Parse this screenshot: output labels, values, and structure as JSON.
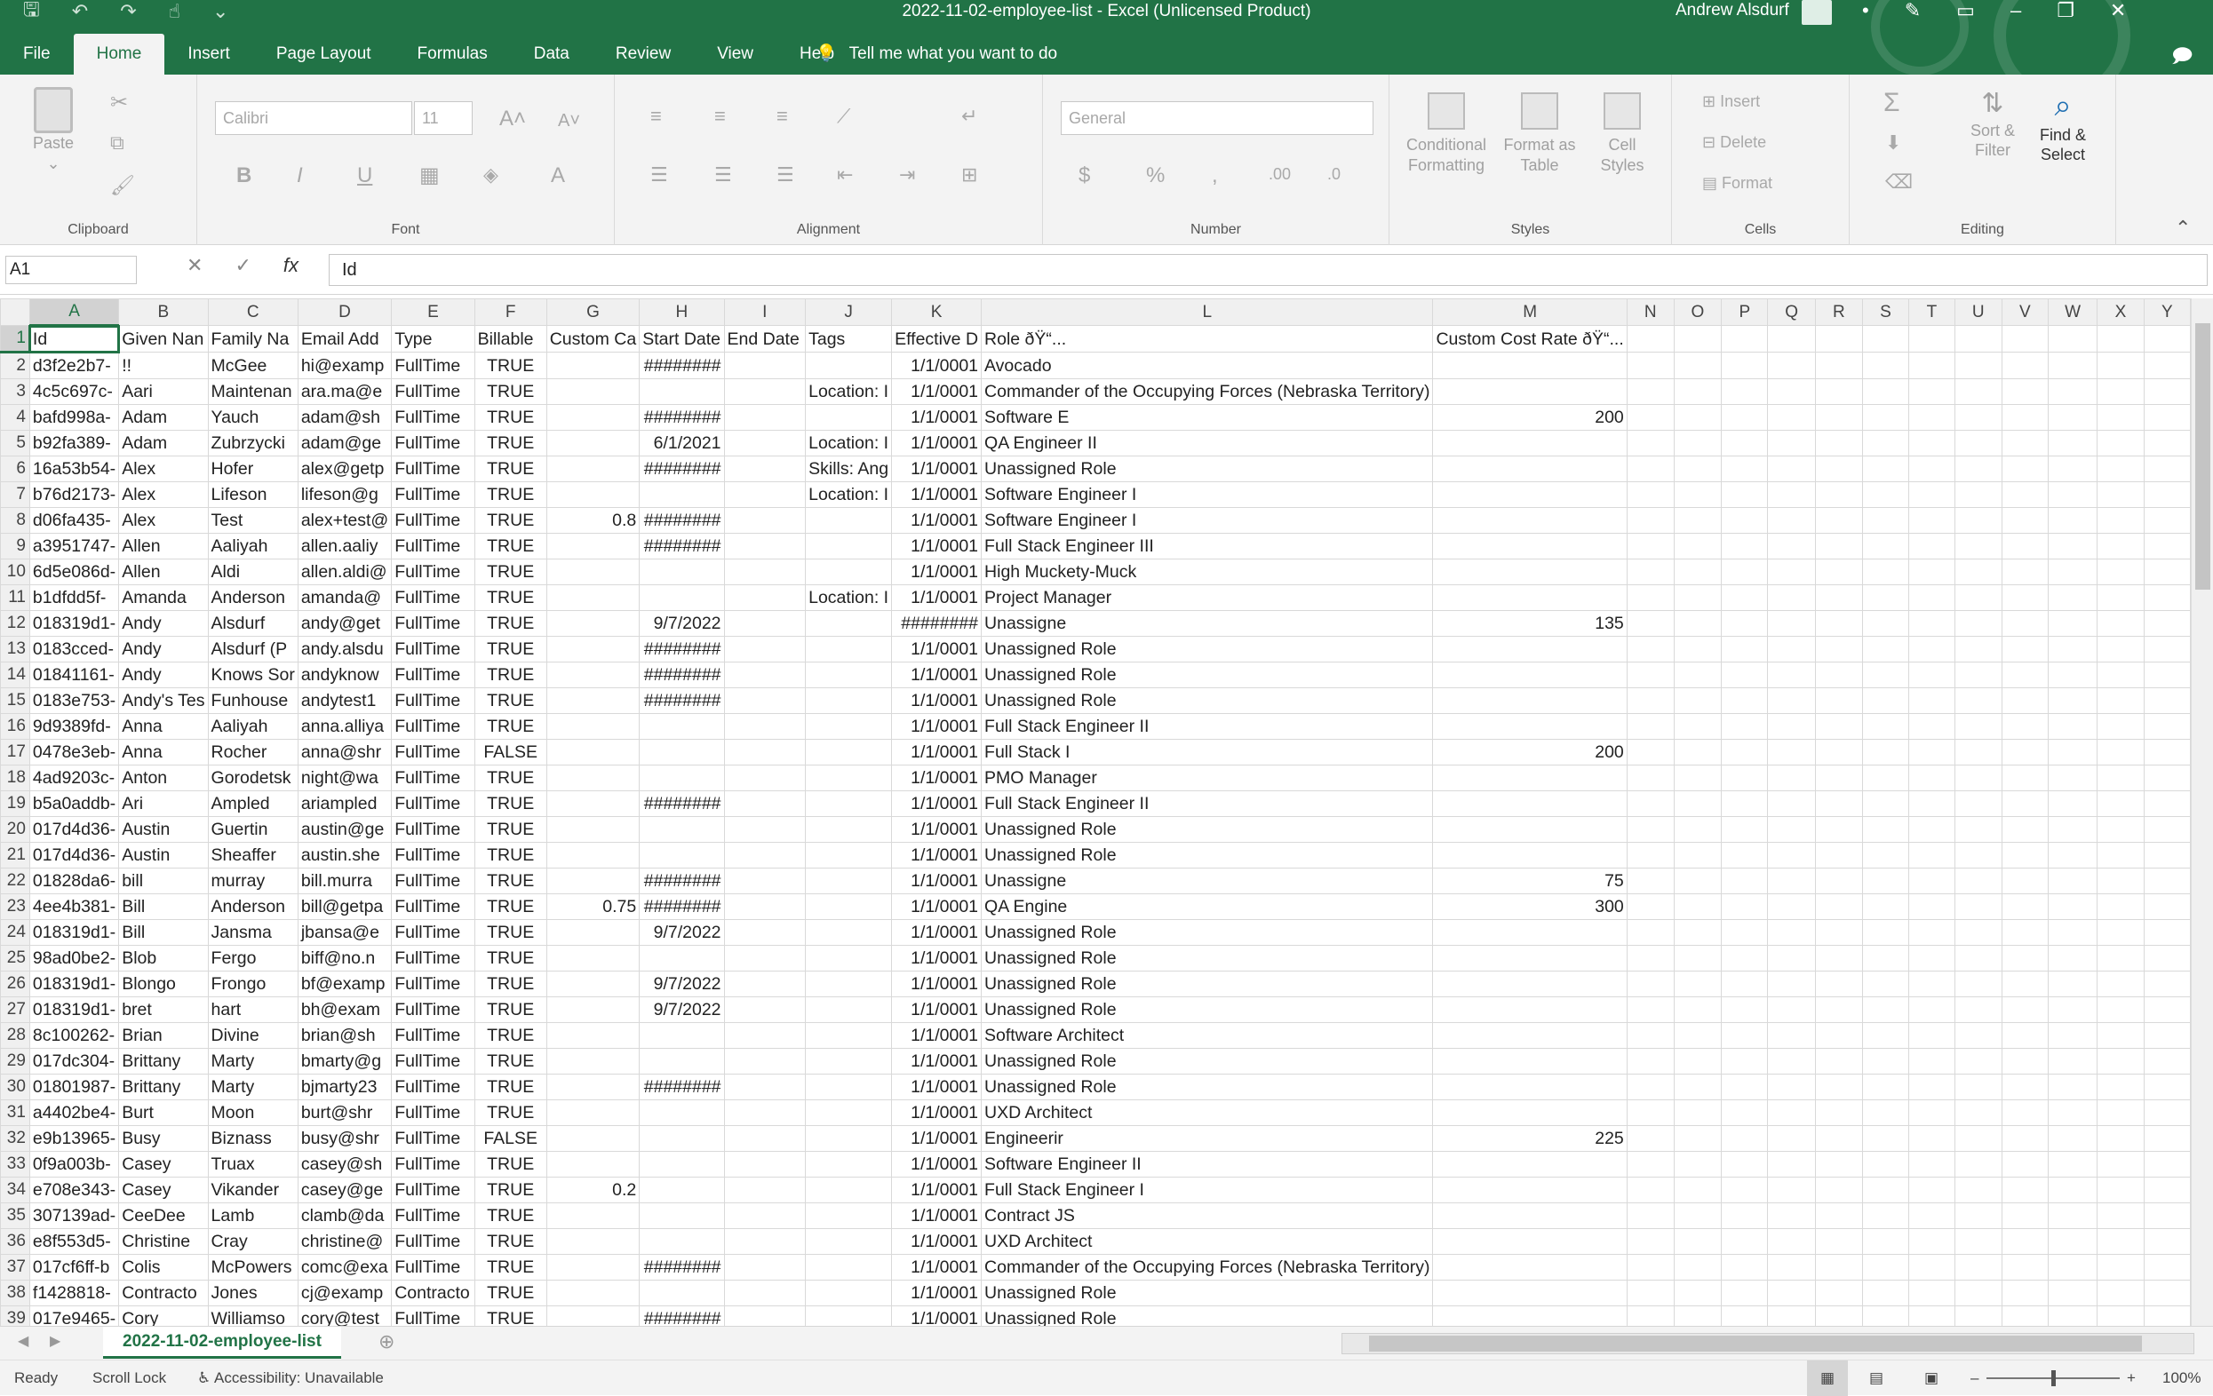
{
  "window": {
    "title": "2022-11-02-employee-list  -  Excel (Unlicensed Product)",
    "user": "Andrew Alsdurf"
  },
  "tabs": [
    "File",
    "Home",
    "Insert",
    "Page Layout",
    "Formulas",
    "Data",
    "Review",
    "View",
    "Help"
  ],
  "tell_me": "Tell me what you want to do",
  "ribbon": {
    "clipboard": {
      "label": "Clipboard",
      "paste": "Paste"
    },
    "font": {
      "label": "Font",
      "name": "Calibri",
      "size": "11"
    },
    "alignment": {
      "label": "Alignment"
    },
    "number": {
      "label": "Number",
      "format": "General"
    },
    "styles": {
      "label": "Styles",
      "conditional": "Conditional Formatting",
      "format_table": "Format as Table",
      "cell_styles": "Cell Styles"
    },
    "cells": {
      "label": "Cells",
      "insert": "Insert",
      "delete": "Delete",
      "format": "Format"
    },
    "editing": {
      "label": "Editing",
      "sort": "Sort & Filter",
      "find": "Find & Select"
    }
  },
  "formula_bar": {
    "name_box": "A1",
    "formula": "Id"
  },
  "columns": [
    "A",
    "B",
    "C",
    "D",
    "E",
    "F",
    "G",
    "H",
    "I",
    "J",
    "K",
    "L",
    "M",
    "N",
    "O",
    "P",
    "Q",
    "R",
    "S",
    "T",
    "U",
    "V",
    "W",
    "X",
    "Y"
  ],
  "headers": [
    "Id",
    "Given Nan",
    "Family Na",
    "Email Add",
    "Type",
    "Billable",
    "Custom Ca",
    "Start Date",
    "End Date",
    "Tags",
    "Effective D",
    "Role ðŸ“...",
    "Custom Cost Rate ðŸ“..."
  ],
  "rows": [
    [
      "d3f2e2b7-",
      "!!",
      "McGee",
      "hi@examp",
      "FullTime",
      "TRUE",
      "",
      "########",
      "",
      "",
      "1/1/0001",
      "Avocado",
      ""
    ],
    [
      "4c5c697c-",
      "Aari",
      "Maintenan",
      "ara.ma@e",
      "FullTime",
      "TRUE",
      "",
      "",
      "",
      "Location: I",
      "1/1/0001",
      "Commander of the Occupying Forces (Nebraska Territory)",
      ""
    ],
    [
      "bafd998a-",
      "Adam",
      "Yauch",
      "adam@sh",
      "FullTime",
      "TRUE",
      "",
      "########",
      "",
      "",
      "1/1/0001",
      "Software E",
      "200"
    ],
    [
      "b92fa389-",
      "Adam",
      "Zubrzycki",
      "adam@ge",
      "FullTime",
      "TRUE",
      "",
      "6/1/2021",
      "",
      "Location: I",
      "1/1/0001",
      "QA Engineer II",
      ""
    ],
    [
      "16a53b54-",
      "Alex",
      "Hofer",
      "alex@getp",
      "FullTime",
      "TRUE",
      "",
      "########",
      "",
      "Skills: Ang",
      "1/1/0001",
      "Unassigned Role",
      ""
    ],
    [
      "b76d2173-",
      "Alex",
      "Lifeson",
      "lifeson@g",
      "FullTime",
      "TRUE",
      "",
      "",
      "",
      "Location: I",
      "1/1/0001",
      "Software Engineer I",
      ""
    ],
    [
      "d06fa435-",
      "Alex",
      "Test",
      "alex+test@",
      "FullTime",
      "TRUE",
      "0.8",
      "########",
      "",
      "",
      "1/1/0001",
      "Software Engineer I",
      ""
    ],
    [
      "a3951747-",
      "Allen",
      "Aaliyah",
      "allen.aaliy",
      "FullTime",
      "TRUE",
      "",
      "########",
      "",
      "",
      "1/1/0001",
      "Full Stack Engineer III",
      ""
    ],
    [
      "6d5e086d-",
      "Allen",
      "Aldi",
      "allen.aldi@",
      "FullTime",
      "TRUE",
      "",
      "",
      "",
      "",
      "1/1/0001",
      "High Muckety-Muck",
      ""
    ],
    [
      "b1dfdd5f-",
      "Amanda",
      "Anderson",
      "amanda@",
      "FullTime",
      "TRUE",
      "",
      "",
      "",
      "Location: I",
      "1/1/0001",
      "Project Manager",
      ""
    ],
    [
      "018319d1-",
      "Andy",
      "Alsdurf",
      "andy@get",
      "FullTime",
      "TRUE",
      "",
      "9/7/2022",
      "",
      "",
      "########",
      "Unassigne",
      "135"
    ],
    [
      "0183cced-",
      "Andy",
      "Alsdurf (P",
      "andy.alsdu",
      "FullTime",
      "TRUE",
      "",
      "########",
      "",
      "",
      "1/1/0001",
      "Unassigned Role",
      ""
    ],
    [
      "01841161-",
      "Andy",
      "Knows Sor",
      "andyknow",
      "FullTime",
      "TRUE",
      "",
      "########",
      "",
      "",
      "1/1/0001",
      "Unassigned Role",
      ""
    ],
    [
      "0183e753-",
      "Andy's Tes",
      "Funhouse",
      "andytest1",
      "FullTime",
      "TRUE",
      "",
      "########",
      "",
      "",
      "1/1/0001",
      "Unassigned Role",
      ""
    ],
    [
      "9d9389fd-",
      "Anna",
      "Aaliyah",
      "anna.alliya",
      "FullTime",
      "TRUE",
      "",
      "",
      "",
      "",
      "1/1/0001",
      "Full Stack Engineer II",
      ""
    ],
    [
      "0478e3eb-",
      "Anna",
      "Rocher",
      "anna@shr",
      "FullTime",
      "FALSE",
      "",
      "",
      "",
      "",
      "1/1/0001",
      "Full Stack I",
      "200"
    ],
    [
      "4ad9203c-",
      "Anton",
      "Gorodetsk",
      "night@wa",
      "FullTime",
      "TRUE",
      "",
      "",
      "",
      "",
      "1/1/0001",
      "PMO Manager",
      ""
    ],
    [
      "b5a0addb-",
      "Ari",
      "Ampled",
      "ariampled",
      "FullTime",
      "TRUE",
      "",
      "########",
      "",
      "",
      "1/1/0001",
      "Full Stack Engineer II",
      ""
    ],
    [
      "017d4d36-",
      "Austin",
      "Guertin",
      "austin@ge",
      "FullTime",
      "TRUE",
      "",
      "",
      "",
      "",
      "1/1/0001",
      "Unassigned Role",
      ""
    ],
    [
      "017d4d36-",
      "Austin",
      "Sheaffer",
      "austin.she",
      "FullTime",
      "TRUE",
      "",
      "",
      "",
      "",
      "1/1/0001",
      "Unassigned Role",
      ""
    ],
    [
      "01828da6-",
      "bill",
      "murray",
      "bill.murra",
      "FullTime",
      "TRUE",
      "",
      "########",
      "",
      "",
      "1/1/0001",
      "Unassigne",
      "75"
    ],
    [
      "4ee4b381-",
      "Bill",
      "Anderson",
      "bill@getpa",
      "FullTime",
      "TRUE",
      "0.75",
      "########",
      "",
      "",
      "1/1/0001",
      "QA Engine",
      "300"
    ],
    [
      "018319d1-",
      "Bill",
      "Jansma",
      "jbansa@e",
      "FullTime",
      "TRUE",
      "",
      "9/7/2022",
      "",
      "",
      "1/1/0001",
      "Unassigned Role",
      ""
    ],
    [
      "98ad0be2-",
      "Blob",
      "Fergo",
      "biff@no.n",
      "FullTime",
      "TRUE",
      "",
      "",
      "",
      "",
      "1/1/0001",
      "Unassigned Role",
      ""
    ],
    [
      "018319d1-",
      "Blongo",
      "Frongo",
      "bf@examp",
      "FullTime",
      "TRUE",
      "",
      "9/7/2022",
      "",
      "",
      "1/1/0001",
      "Unassigned Role",
      ""
    ],
    [
      "018319d1-",
      "bret",
      "hart",
      "bh@exam",
      "FullTime",
      "TRUE",
      "",
      "9/7/2022",
      "",
      "",
      "1/1/0001",
      "Unassigned Role",
      ""
    ],
    [
      "8c100262-",
      "Brian",
      "Divine",
      "brian@sh",
      "FullTime",
      "TRUE",
      "",
      "",
      "",
      "",
      "1/1/0001",
      "Software Architect",
      ""
    ],
    [
      "017dc304-",
      "Brittany",
      "Marty",
      "bmarty@g",
      "FullTime",
      "TRUE",
      "",
      "",
      "",
      "",
      "1/1/0001",
      "Unassigned Role",
      ""
    ],
    [
      "01801987-",
      "Brittany",
      "Marty",
      "bjmarty23",
      "FullTime",
      "TRUE",
      "",
      "########",
      "",
      "",
      "1/1/0001",
      "Unassigned Role",
      ""
    ],
    [
      "a4402be4-",
      "Burt",
      "Moon",
      "burt@shr",
      "FullTime",
      "TRUE",
      "",
      "",
      "",
      "",
      "1/1/0001",
      "UXD Architect",
      ""
    ],
    [
      "e9b13965-",
      "Busy",
      "Biznass",
      "busy@shr",
      "FullTime",
      "FALSE",
      "",
      "",
      "",
      "",
      "1/1/0001",
      "Engineerir",
      "225"
    ],
    [
      "0f9a003b-",
      "Casey",
      "Truax",
      "casey@sh",
      "FullTime",
      "TRUE",
      "",
      "",
      "",
      "",
      "1/1/0001",
      "Software Engineer II",
      ""
    ],
    [
      "e708e343-",
      "Casey",
      "Vikander",
      "casey@ge",
      "FullTime",
      "TRUE",
      "0.2",
      "",
      "",
      "",
      "1/1/0001",
      "Full Stack Engineer I",
      ""
    ],
    [
      "307139ad-",
      "CeeDee",
      "Lamb",
      "clamb@da",
      "FullTime",
      "TRUE",
      "",
      "",
      "",
      "",
      "1/1/0001",
      "Contract JS",
      ""
    ],
    [
      "e8f553d5-",
      "Christine",
      "Cray",
      "christine@",
      "FullTime",
      "TRUE",
      "",
      "",
      "",
      "",
      "1/1/0001",
      "UXD Architect",
      ""
    ],
    [
      "017cf6ff-b",
      "Colis",
      "McPowers",
      "comc@exa",
      "FullTime",
      "TRUE",
      "",
      "########",
      "",
      "",
      "1/1/0001",
      "Commander of the Occupying Forces (Nebraska Territory)",
      ""
    ],
    [
      "f1428818-",
      "Contracto",
      "Jones",
      "cj@examp",
      "Contracto",
      "TRUE",
      "",
      "",
      "",
      "",
      "1/1/0001",
      "Unassigned Role",
      ""
    ],
    [
      "017e9465-",
      "Cory",
      "Williamso",
      "cory@test",
      "FullTime",
      "TRUE",
      "",
      "########",
      "",
      "",
      "1/1/0001",
      "Unassigned Role",
      ""
    ]
  ],
  "sheet_tab": "2022-11-02-employee-list",
  "status": {
    "ready": "Ready",
    "scroll_lock": "Scroll Lock",
    "accessibility": "Accessibility: Unavailable",
    "zoom": "100%"
  }
}
